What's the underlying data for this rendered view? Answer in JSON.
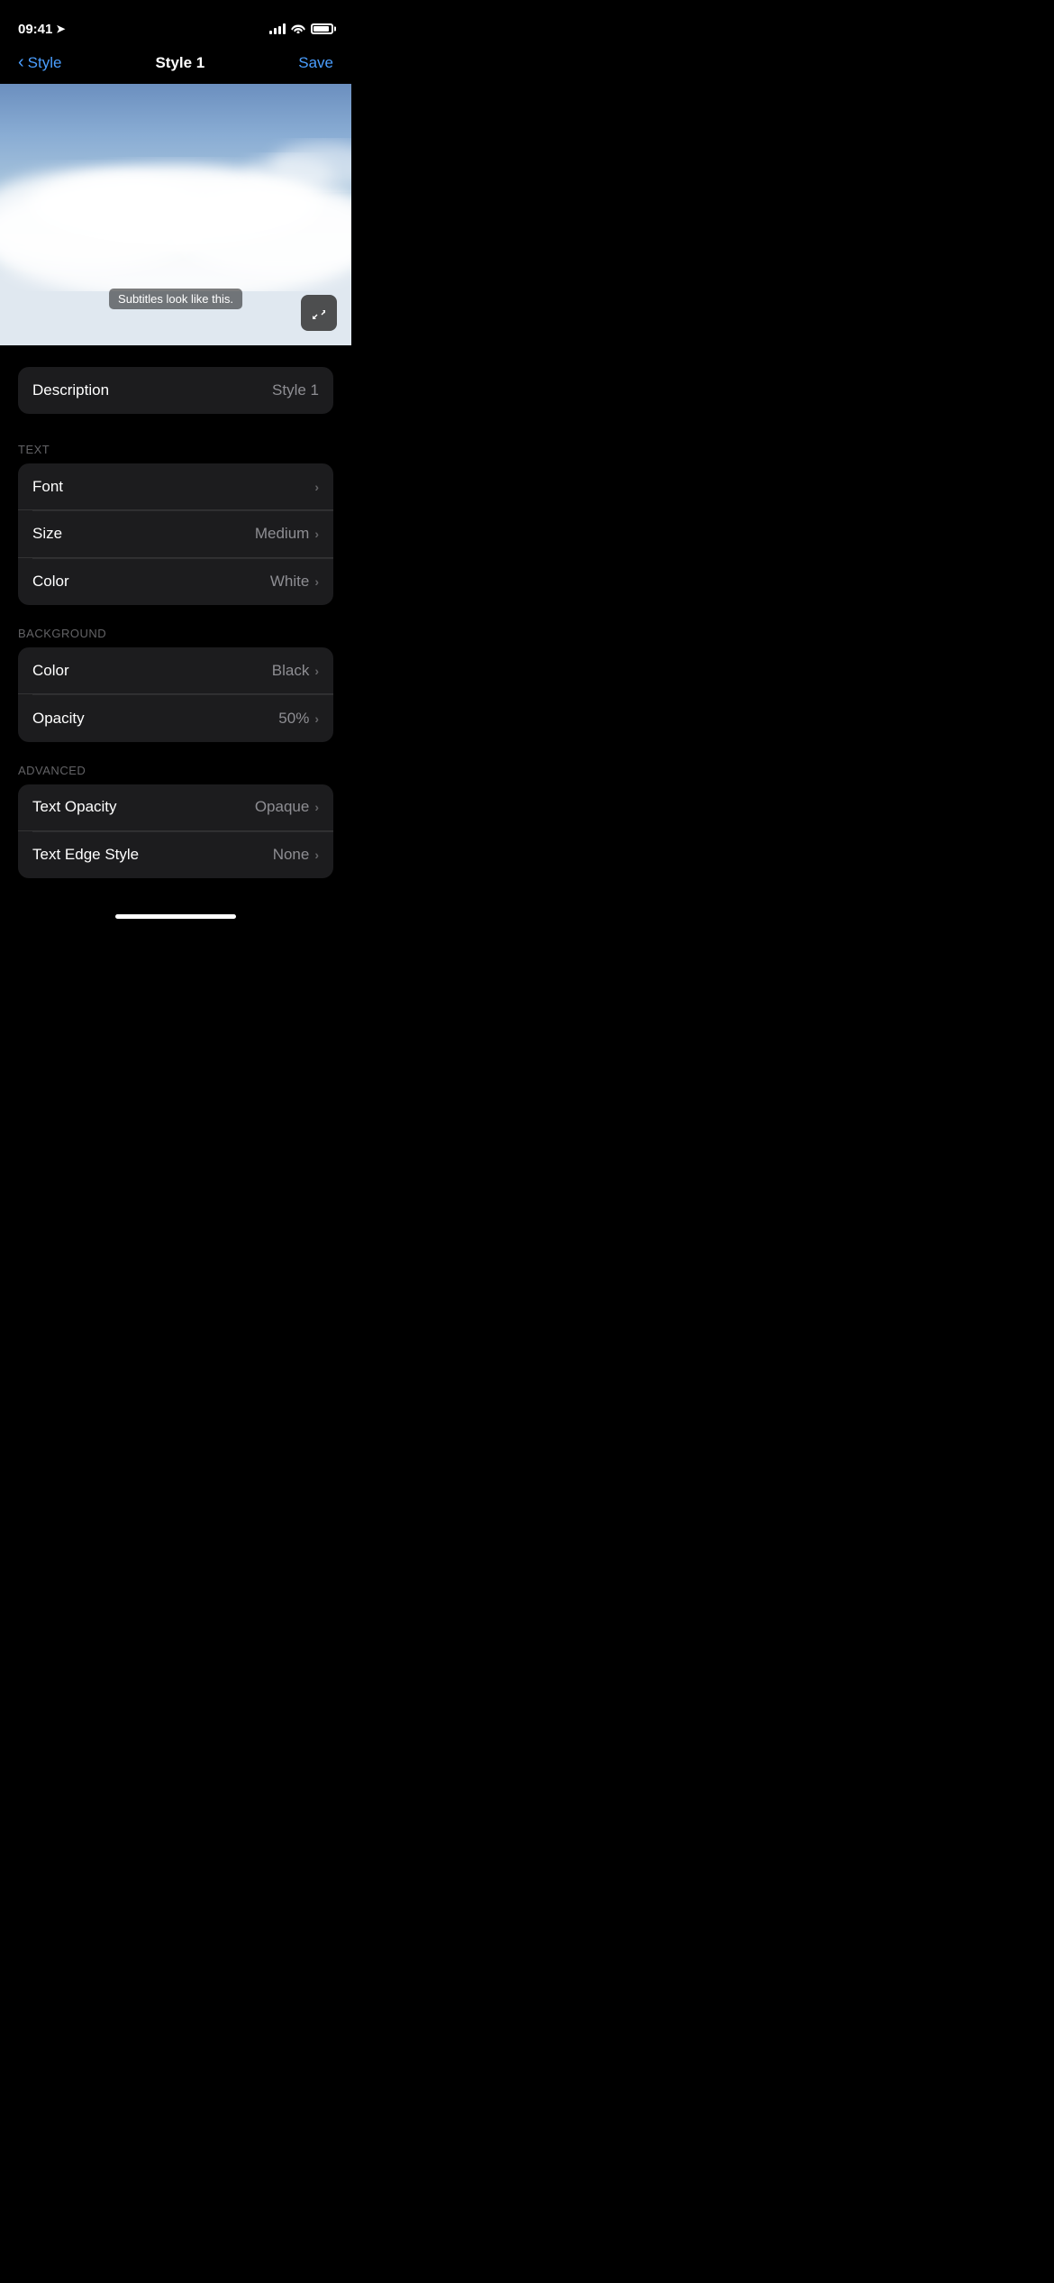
{
  "statusBar": {
    "time": "09:41",
    "locationIcon": "◂",
    "batteryFull": true
  },
  "navBar": {
    "backLabel": "Style",
    "title": "Style 1",
    "saveLabel": "Save"
  },
  "preview": {
    "subtitleText": "Subtitles look like this.",
    "expandIcon": "⤢"
  },
  "descriptionSection": {
    "label": "Description",
    "value": "Style 1"
  },
  "textSection": {
    "header": "TEXT",
    "rows": [
      {
        "label": "Font",
        "value": ""
      },
      {
        "label": "Size",
        "value": "Medium"
      },
      {
        "label": "Color",
        "value": "White"
      }
    ]
  },
  "backgroundSection": {
    "header": "BACKGROUND",
    "rows": [
      {
        "label": "Color",
        "value": "Black"
      },
      {
        "label": "Opacity",
        "value": "50%"
      }
    ]
  },
  "advancedSection": {
    "header": "ADVANCED",
    "rows": [
      {
        "label": "Text Opacity",
        "value": "Opaque"
      },
      {
        "label": "Text Edge Style",
        "value": "None"
      }
    ]
  }
}
